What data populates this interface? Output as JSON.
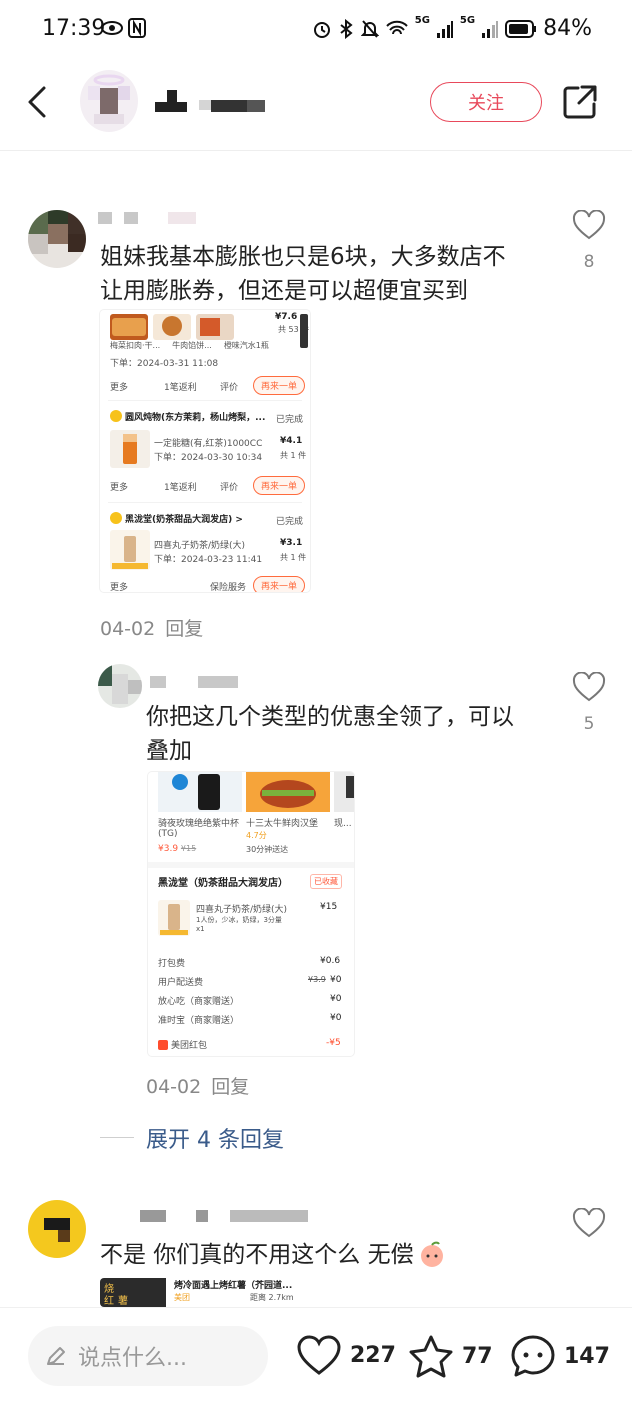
{
  "status_bar": {
    "time": "17:39",
    "battery": "84%",
    "signal1": "5G",
    "signal2": "5G"
  },
  "header": {
    "follow_label": "关注"
  },
  "comments": [
    {
      "text_line1": "姐妹我基本膨胀也只是6块，大多数店不",
      "text_line2": "让用膨胀券，但还是可以超便宜买到",
      "likes": "8",
      "date": "04-02",
      "reply_label": "回复",
      "shot": {
        "top_items": [
          "梅菜扣肉·干...",
          "牛肉馅饼...",
          "橙味汽水1瓶"
        ],
        "top_price": "¥7.6",
        "top_count": "共 53 件",
        "top_order": "下单：2024-03-31 11:08",
        "top_more": "更多",
        "top_actions": [
          "1笔返利",
          "评价",
          "再来一单"
        ],
        "orders": [
          {
            "shop": "圆风炖物(东方茉莉，杨山烤梨，...",
            "status": "已完成",
            "item": "一定能糖(有,红茶)1000CC",
            "date": "下单：2024-03-30 10:34",
            "price": "¥4.1",
            "count": "共 1 件",
            "more": "更多",
            "actions": [
              "1笔返利",
              "评价",
              "再来一单"
            ]
          },
          {
            "shop": "黑泷堂(奶茶甜品大润发店) >",
            "status": "已完成",
            "item": "四喜丸子奶茶/奶绿(大)",
            "date": "下单：2024-03-23 11:41",
            "price": "¥3.1",
            "count": "共 1 件",
            "more": "更多",
            "actions": [
              "保险服务",
              "再来一单"
            ]
          }
        ]
      }
    },
    {
      "text_line1": "你把这几个类型的优惠全领了，可以",
      "text_line2": "叠加",
      "likes": "5",
      "date": "04-02",
      "reply_label": "回复",
      "shot": {
        "products": [
          {
            "name": "骑夜玫瑰绝绝紫中杯(TG)",
            "price": "¥3.9",
            "old": "¥15"
          },
          {
            "name": "十三太牛鲜肉汉堡",
            "rating": "4.7分",
            "eta": "30分钟送达"
          },
          {
            "name": "现..."
          }
        ],
        "shop": "黑泷堂（奶茶甜品大润发店）",
        "tag": "已收藏",
        "item": "四喜丸子奶茶/奶绿(大)",
        "item_desc": "1人份，少冰，奶绿，3分量",
        "item_qty": "x1",
        "item_price": "¥15",
        "fees": [
          {
            "label": "打包费",
            "old": "",
            "value": "¥0.6"
          },
          {
            "label": "用户配送费",
            "old": "¥3.9",
            "value": "¥0"
          },
          {
            "label": "放心吃（商家赠送）",
            "old": "",
            "value": "¥0"
          },
          {
            "label": "准时宝（商家赠送）",
            "old": "",
            "value": "¥0"
          }
        ],
        "redpack_label": "美团红包",
        "redpack_value": "-¥5"
      }
    }
  ],
  "expand_label": "展开 4 条回复",
  "comment3": {
    "text": "不是 你们真的不用这个么 无偿",
    "thumb_title": "烤冷面遇上烤红薯（芥园道...",
    "thumb_sub": "美团",
    "thumb_dist": "距离 2.7km",
    "thumb_side1": "烧",
    "thumb_side2": "红",
    "thumb_side3": "薯"
  },
  "bottom_bar": {
    "placeholder": "说点什么...",
    "likes": "227",
    "stars": "77",
    "comments": "147"
  },
  "colors": {
    "accent": "#e8495b",
    "link": "#3a5b8a",
    "orange": "#ff6b3d"
  }
}
